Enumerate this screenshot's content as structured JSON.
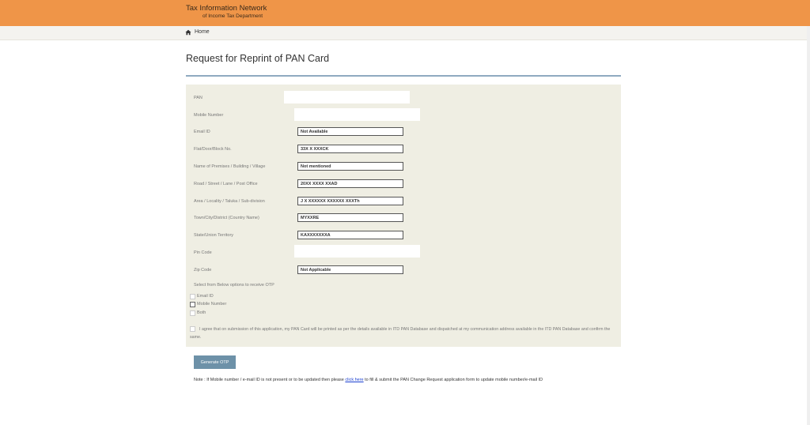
{
  "header": {
    "title": "Tax Information Network",
    "subtitle": "of Income Tax Department",
    "brand_color": "#ef9548"
  },
  "breadcrumb": {
    "home_icon": "home-icon",
    "home_label": "Home"
  },
  "page": {
    "title": "Request for Reprint of PAN Card"
  },
  "form": {
    "fields": [
      {
        "label": "PAN",
        "value": ""
      },
      {
        "label": "Mobile Number",
        "value": ""
      },
      {
        "label": "Email ID",
        "value": "Not Available"
      },
      {
        "label": "Flat/Door/Block No.",
        "value": "33X X XXXCK"
      },
      {
        "label": "Name of Premises / Building / Village",
        "value": "Not mentioned"
      },
      {
        "label": "Road / Street / Lane / Post Office",
        "value": "20XX XXXX XXAD"
      },
      {
        "label": "Area / Locality / Taluka / Sub-division",
        "value": "J X XXXXXX XXXXXX XXXTh"
      },
      {
        "label": "Town/City/District (Country Name)",
        "value": "MYXXRE"
      },
      {
        "label": "State/Union Territory",
        "value": "KAXXXXXXXA"
      },
      {
        "label": "Pin Code",
        "value": ""
      },
      {
        "label": "Zip Code",
        "value": "Not Applicable"
      }
    ],
    "otp_prompt": "Select from Below options to receive OTP",
    "otp_options": [
      {
        "label": "Email ID"
      },
      {
        "label": "Mobile Number"
      },
      {
        "label": "Both"
      }
    ],
    "agreement": "I agree that on submission of this application, my PAN Card will be printed as per the details available in ITD PAN Database and dispatched at my communication address available in the ITD PAN Database and confirm the same.",
    "generate_otp_label": "Generate OTP"
  },
  "note": {
    "prefix": "Note : If Mobile number / e-mail ID is not present or to be updated then please",
    "link": "click here",
    "suffix": "to fill & submit the PAN Change Request application form to update mobile number/e-mail ID"
  }
}
